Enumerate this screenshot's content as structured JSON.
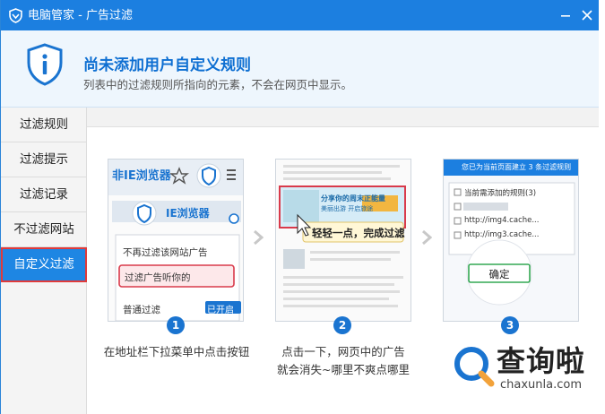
{
  "window": {
    "app_name": "电脑管家",
    "separator": " - ",
    "title": "广告过滤"
  },
  "header": {
    "heading": "尚未添加用户自定义规则",
    "description": "列表中的过滤规则所指向的元素，不会在网页中显示。"
  },
  "sidebar": {
    "items": [
      {
        "label": "过滤规则"
      },
      {
        "label": "过滤提示"
      },
      {
        "label": "过滤记录"
      },
      {
        "label": "不过滤网站"
      },
      {
        "label": "自定义过滤",
        "active": true
      }
    ]
  },
  "steps": [
    {
      "number": "1",
      "caption_line1": "在地址栏下拉菜单中点击按钮",
      "caption_line2": "",
      "browser_badge_top": "非IE浏览器",
      "browser_badge_ie": "IE浏览器",
      "menu_item1": "不再过滤该网站广告",
      "menu_item2": "过滤广告听你的",
      "menu_item3": "普通过滤",
      "toggle_label": "已开启"
    },
    {
      "number": "2",
      "caption_line1": "点击一下，网页中的广告",
      "caption_line2": "就会消失~哪里不爽点哪里",
      "tooltip": "轻轻一点，完成过滤",
      "ad_text1": "分享你的周末正能量",
      "ad_text2": "美丽出游 开启旅途"
    },
    {
      "number": "3",
      "caption_line1": "",
      "caption_line2": "",
      "dialog_title": "您已为当前页面建立 3 条过滤规则",
      "rules_label": "当前需添加的规则(3)",
      "rule1": "http://img4.cache...",
      "rule2": "http://img3.cache...",
      "confirm_label": "确定"
    }
  ],
  "watermark": {
    "text": "查询啦",
    "domain": "chaxunla.com"
  },
  "colors": {
    "titlebar": "#1c7fe0",
    "accent": "#0e6fd2",
    "active_item": "#1e86e3",
    "highlight_border": "#e03a3a"
  }
}
